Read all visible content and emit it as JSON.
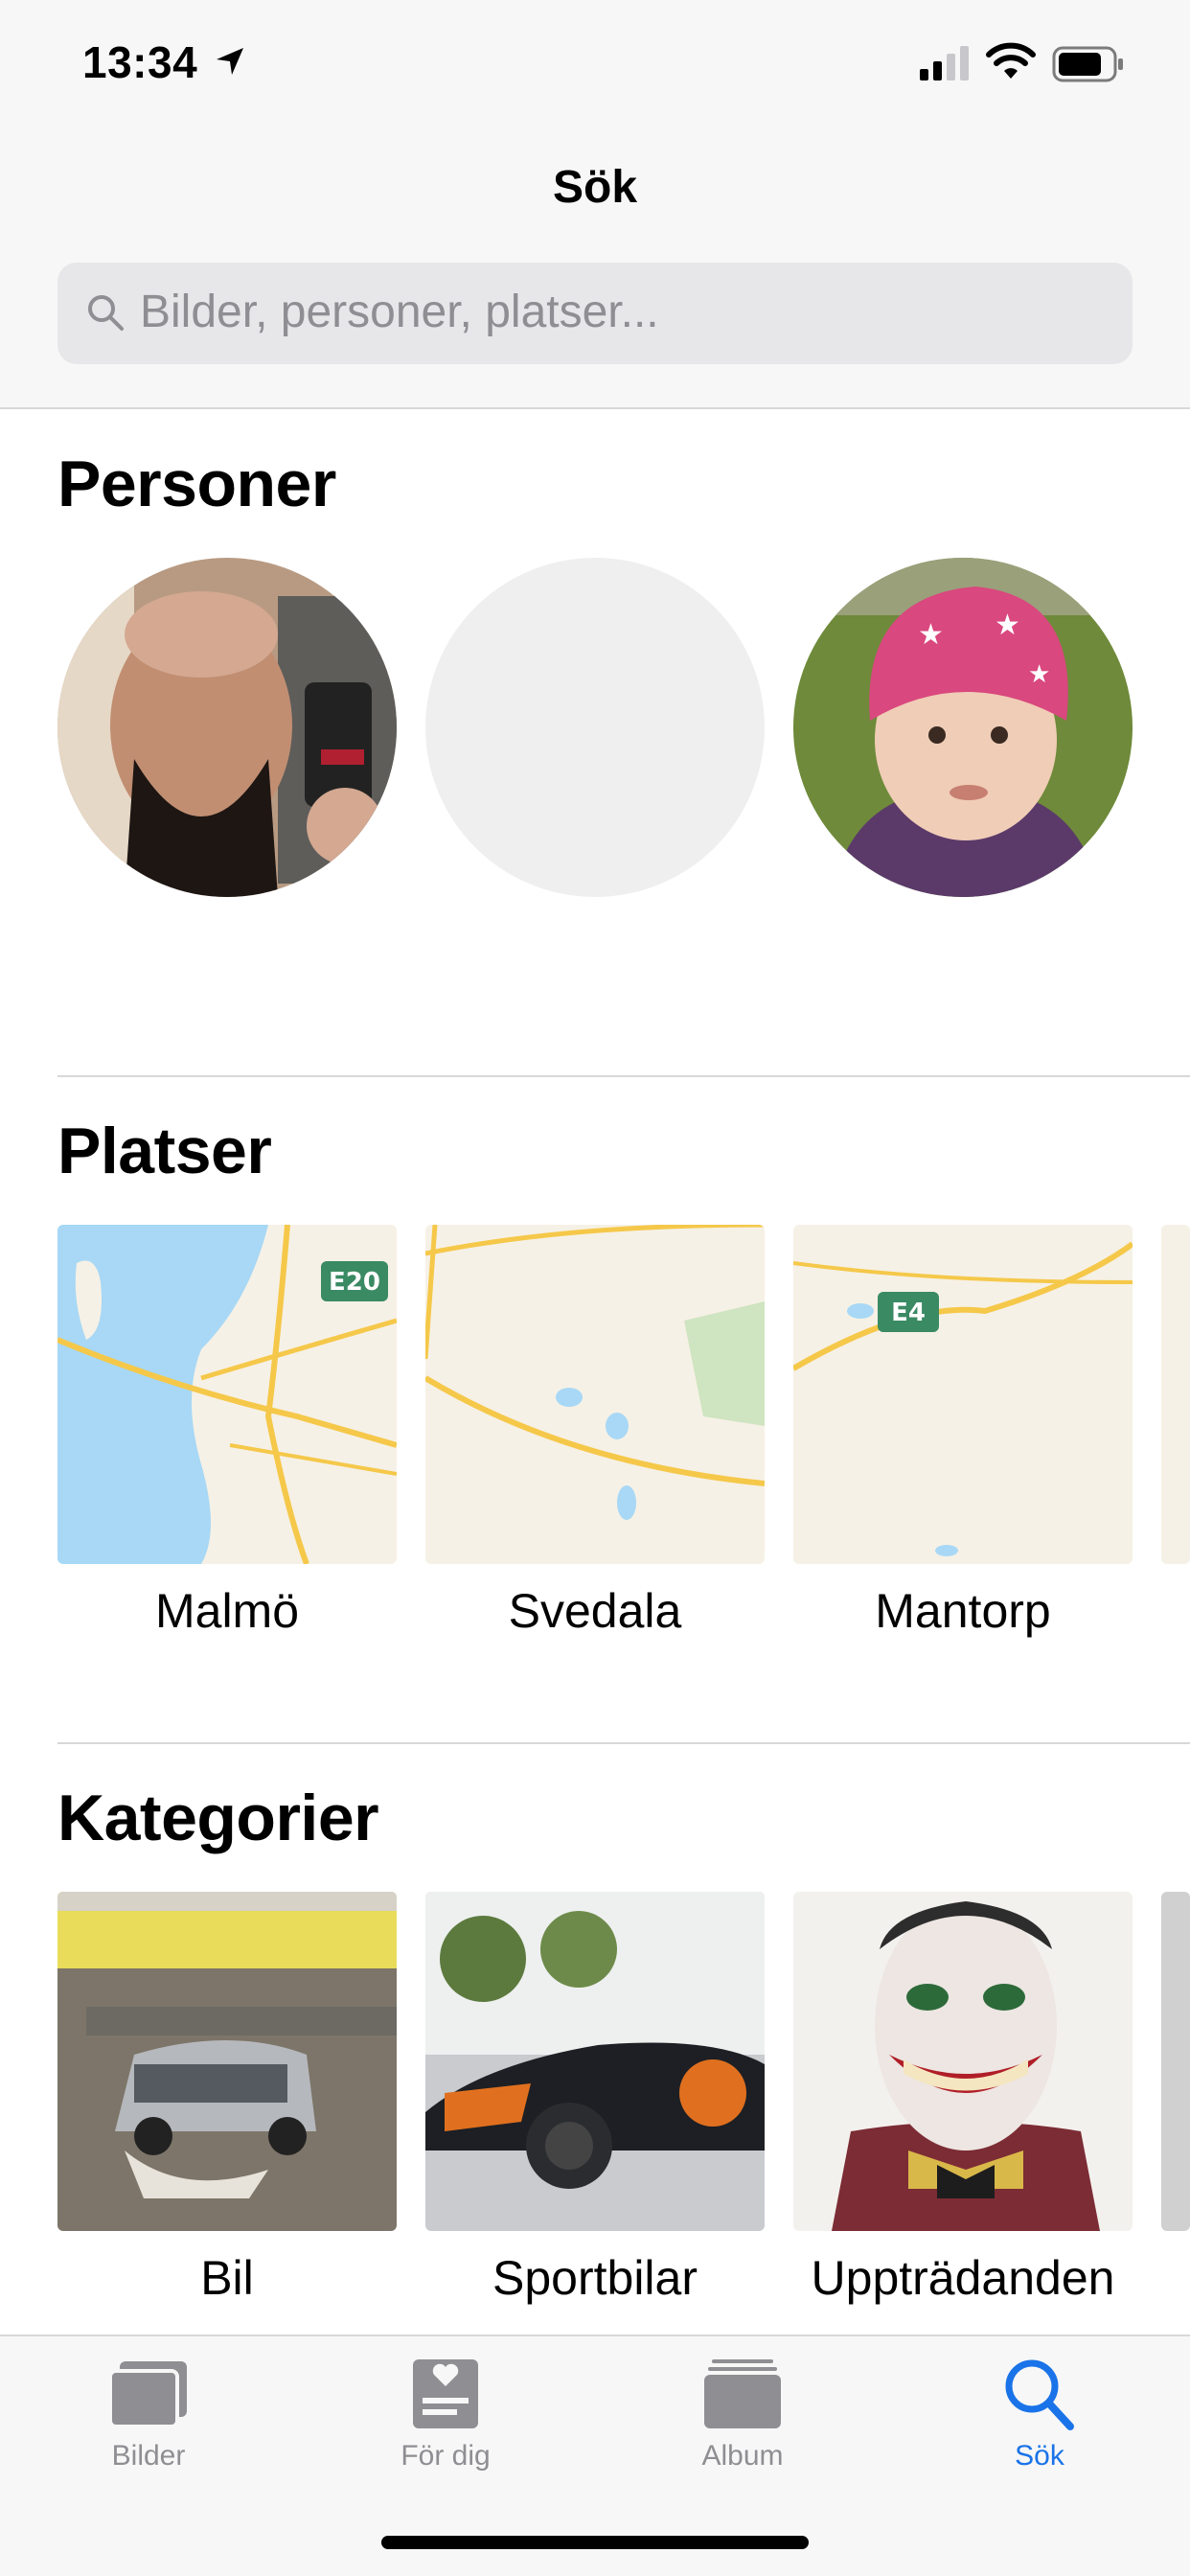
{
  "status": {
    "time": "13:34"
  },
  "nav": {
    "title": "Sök"
  },
  "search": {
    "placeholder": "Bilder, personer, platser..."
  },
  "sections": {
    "people": {
      "title": "Personer"
    },
    "places": {
      "title": "Platser",
      "items": [
        {
          "label": "Malmö",
          "road_sign": "E20"
        },
        {
          "label": "Svedala"
        },
        {
          "label": "Mantorp",
          "road_sign": "E4"
        }
      ]
    },
    "categories": {
      "title": "Kategorier",
      "items": [
        {
          "label": "Bil"
        },
        {
          "label": "Sportbilar"
        },
        {
          "label": "Uppträdanden"
        }
      ]
    }
  },
  "tabs": [
    {
      "label": "Bilder",
      "icon": "photos-icon",
      "active": false
    },
    {
      "label": "För dig",
      "icon": "for-you-icon",
      "active": false
    },
    {
      "label": "Album",
      "icon": "album-icon",
      "active": false
    },
    {
      "label": "Sök",
      "icon": "search-icon",
      "active": true
    }
  ],
  "colors": {
    "accent": "#1a73e8",
    "map_water": "#a8d8f5",
    "map_land": "#f6f1e6",
    "map_road": "#f5c84a"
  }
}
